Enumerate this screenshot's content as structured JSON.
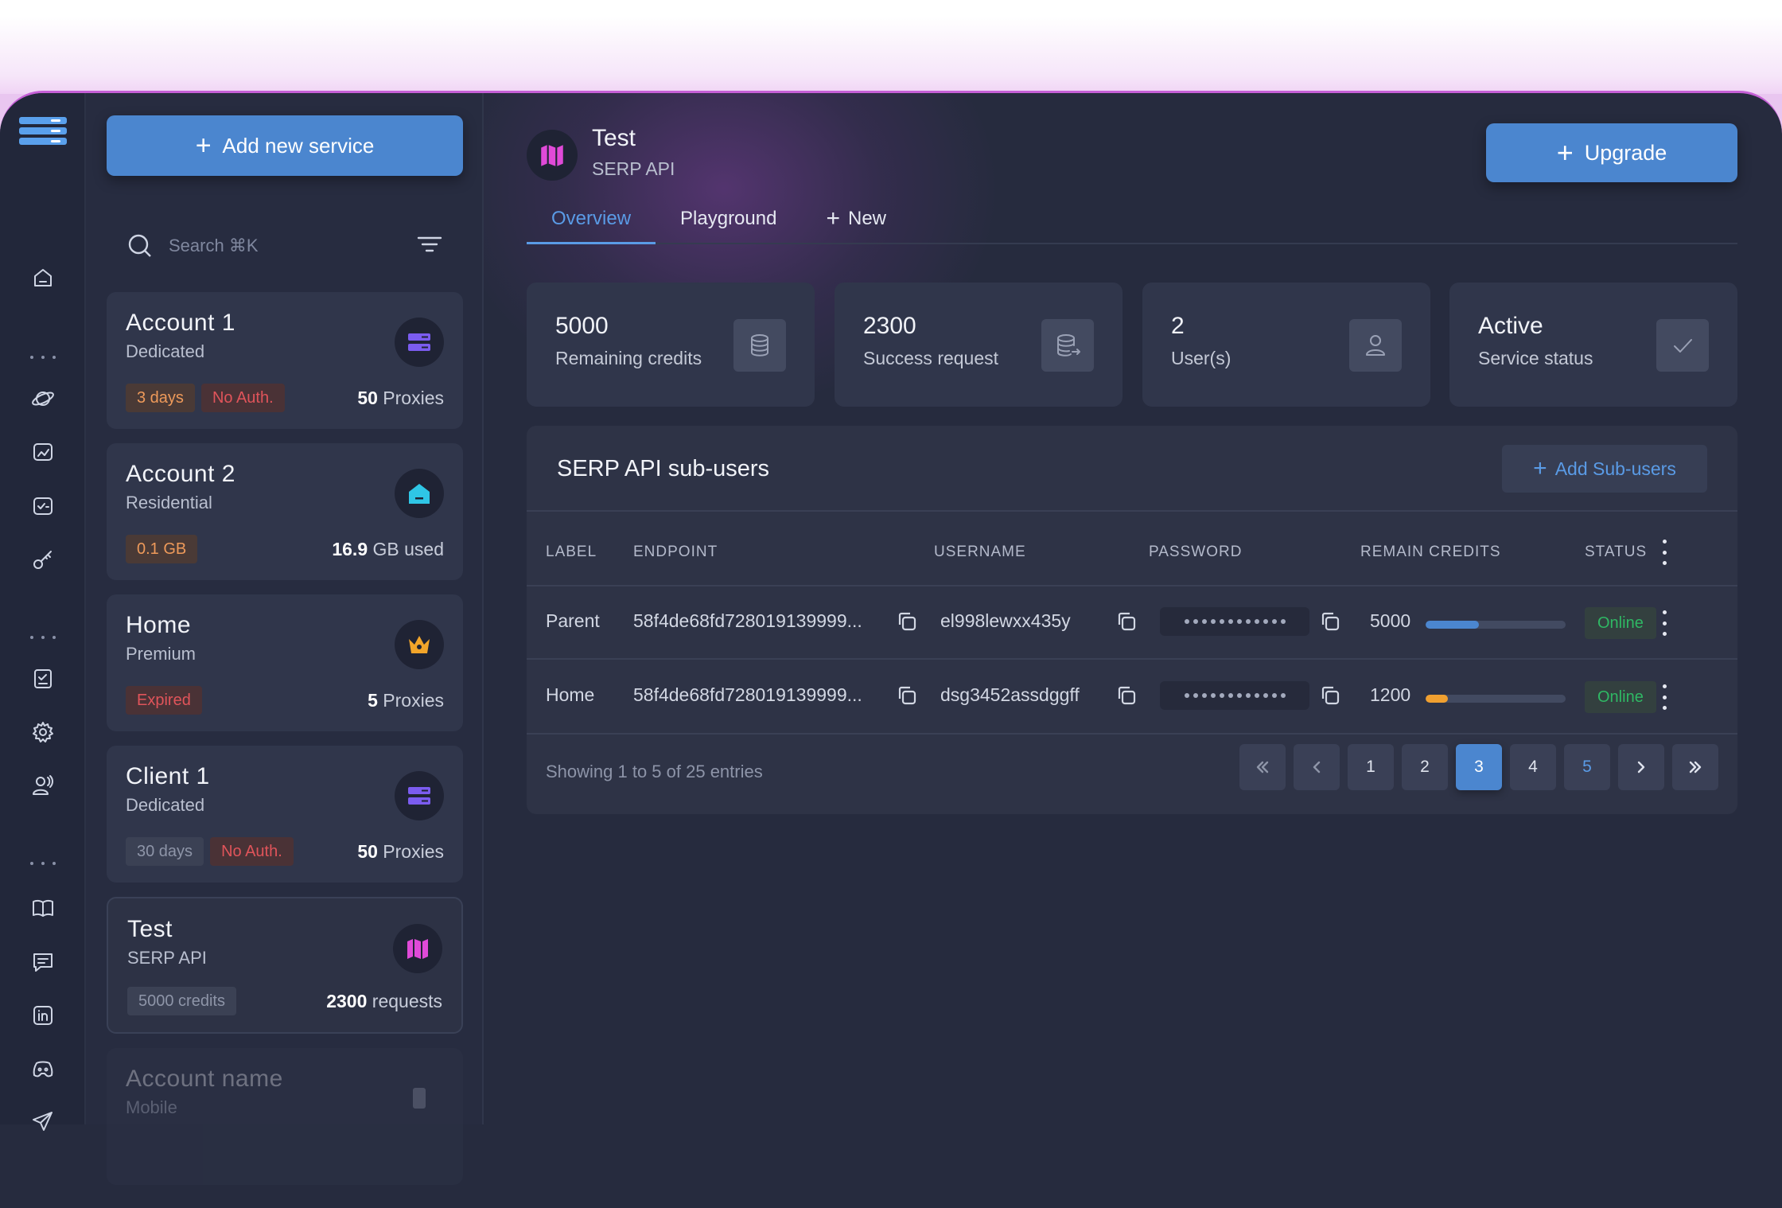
{
  "colors": {
    "accent": "#4b86cf",
    "link": "#5a9be6",
    "online": "#2fb864",
    "frame_border": "#c55fd6"
  },
  "rail": {
    "icons": [
      "logo-icon",
      "home-icon",
      "planet-icon",
      "chart-icon",
      "check-box-icon",
      "key-icon",
      "checklist-icon",
      "gear-icon",
      "users-icon",
      "book-icon",
      "chat-icon",
      "linkedin-icon",
      "discord-icon",
      "send-icon",
      "mail-icon"
    ]
  },
  "sidebar": {
    "add_service_label": "Add new service",
    "search_placeholder": "Search ⌘K",
    "cards": [
      {
        "name": "Account 1",
        "type": "Dedicated",
        "icon": "server-icon",
        "badges": [
          {
            "text": "3 days",
            "tone": "orange"
          },
          {
            "text": "No Auth.",
            "tone": "red"
          }
        ],
        "metric_value": "50",
        "metric_unit": "Proxies"
      },
      {
        "name": "Account 2",
        "type": "Residential",
        "icon": "house-icon",
        "badges": [
          {
            "text": "0.1 GB",
            "tone": "orange"
          }
        ],
        "metric_value": "16.9",
        "metric_unit": "GB used"
      },
      {
        "name": "Home",
        "type": "Premium",
        "icon": "crown-icon",
        "badges": [
          {
            "text": "Expired",
            "tone": "red"
          }
        ],
        "metric_value": "5",
        "metric_unit": "Proxies"
      },
      {
        "name": "Client 1",
        "type": "Dedicated",
        "icon": "server-icon",
        "badges": [
          {
            "text": "30 days",
            "tone": "gray"
          },
          {
            "text": "No Auth.",
            "tone": "red"
          }
        ],
        "metric_value": "50",
        "metric_unit": "Proxies"
      },
      {
        "name": "Test",
        "type": "SERP API",
        "icon": "map-icon",
        "badges": [
          {
            "text": "5000 credits",
            "tone": "gray"
          }
        ],
        "metric_value": "2300",
        "metric_unit": "requests"
      },
      {
        "name": "Account name",
        "type": "Mobile",
        "icon": "phone-icon"
      }
    ]
  },
  "header": {
    "title": "Test",
    "subtitle": "SERP API",
    "upgrade_label": "Upgrade",
    "tabs": [
      {
        "label": "Overview",
        "active": true
      },
      {
        "label": "Playground",
        "active": false
      },
      {
        "label": "New",
        "active": false
      }
    ]
  },
  "stats": [
    {
      "value": "5000",
      "label": "Remaining credits",
      "icon": "database-icon"
    },
    {
      "value": "2300",
      "label": "Success request",
      "icon": "database-export-icon"
    },
    {
      "value": "2",
      "label": "User(s)",
      "icon": "user-icon"
    },
    {
      "value": "Active",
      "label": "Service status",
      "icon": "check-icon"
    }
  ],
  "subusers": {
    "title": "SERP API sub-users",
    "add_label": "Add Sub-users",
    "columns": [
      "LABEL",
      "ENDPOINT",
      "USERNAME",
      "PASSWORD",
      "REMAIN CREDITS",
      "STATUS"
    ],
    "rows": [
      {
        "label": "Parent",
        "endpoint": "58f4de68fd728019139999...",
        "username": "el998lewxx435y",
        "credits": "5000",
        "credits_fraction": 0.38,
        "bar_color": "#4b86cf",
        "status": "Online"
      },
      {
        "label": "Home",
        "endpoint": "58f4de68fd728019139999...",
        "username": "dsg3452assdggff",
        "credits": "1200",
        "credits_fraction": 0.16,
        "bar_color": "#f0a030",
        "status": "Online"
      }
    ],
    "showing": "Showing 1 to 5 of 25 entries",
    "pages": [
      "1",
      "2",
      "3",
      "4",
      "5"
    ],
    "current_page": "3"
  }
}
